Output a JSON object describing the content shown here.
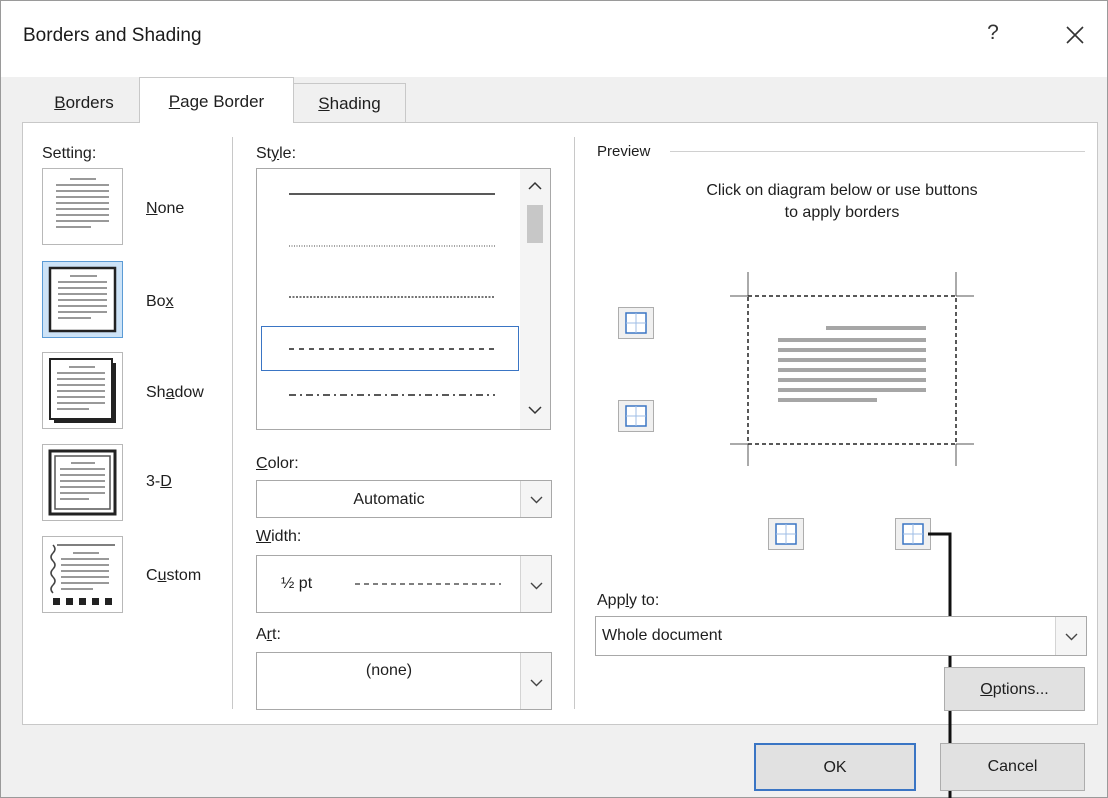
{
  "window": {
    "title": "Borders and Shading",
    "help_label": "?"
  },
  "tabs": [
    {
      "label": "Borders",
      "mnemonic": "B"
    },
    {
      "label": "Page Border",
      "mnemonic": "P"
    },
    {
      "label": "Shading",
      "mnemonic": "S"
    }
  ],
  "active_tab": "Page Border",
  "setting": {
    "heading": "Setting:",
    "selected": "Box",
    "options": [
      {
        "label": "None",
        "mnemonic": "N"
      },
      {
        "label": "Box",
        "mnemonic": "x"
      },
      {
        "label": "Shadow",
        "mnemonic": "a"
      },
      {
        "label": "3-D",
        "mnemonic": "D"
      },
      {
        "label": "Custom",
        "mnemonic": "u"
      }
    ]
  },
  "style": {
    "heading": "Style:",
    "lines": [
      "solid",
      "dotted",
      "dotted-dense",
      "dashed",
      "dash-dot"
    ],
    "selected_index": 3
  },
  "color": {
    "heading": "Color:",
    "value": "Automatic"
  },
  "width": {
    "heading": "Width:",
    "value": "½ pt"
  },
  "art": {
    "heading": "Art:",
    "value": "(none)"
  },
  "preview": {
    "heading": "Preview",
    "instruction_line1": "Click on diagram below or use buttons",
    "instruction_line2": "to apply borders"
  },
  "apply_to": {
    "heading": "Apply to:",
    "value": "Whole document"
  },
  "buttons": {
    "options": "Options...",
    "ok": "OK",
    "cancel": "Cancel"
  },
  "colors": {
    "selection_blue": "#3a75c4",
    "selected_fill": "#cde3f7",
    "button_gray": "#e1e1e1"
  },
  "icons": [
    "close-icon",
    "scroll-up-icon",
    "scroll-down-icon",
    "chevron-down-icon",
    "border-button-icon"
  ]
}
